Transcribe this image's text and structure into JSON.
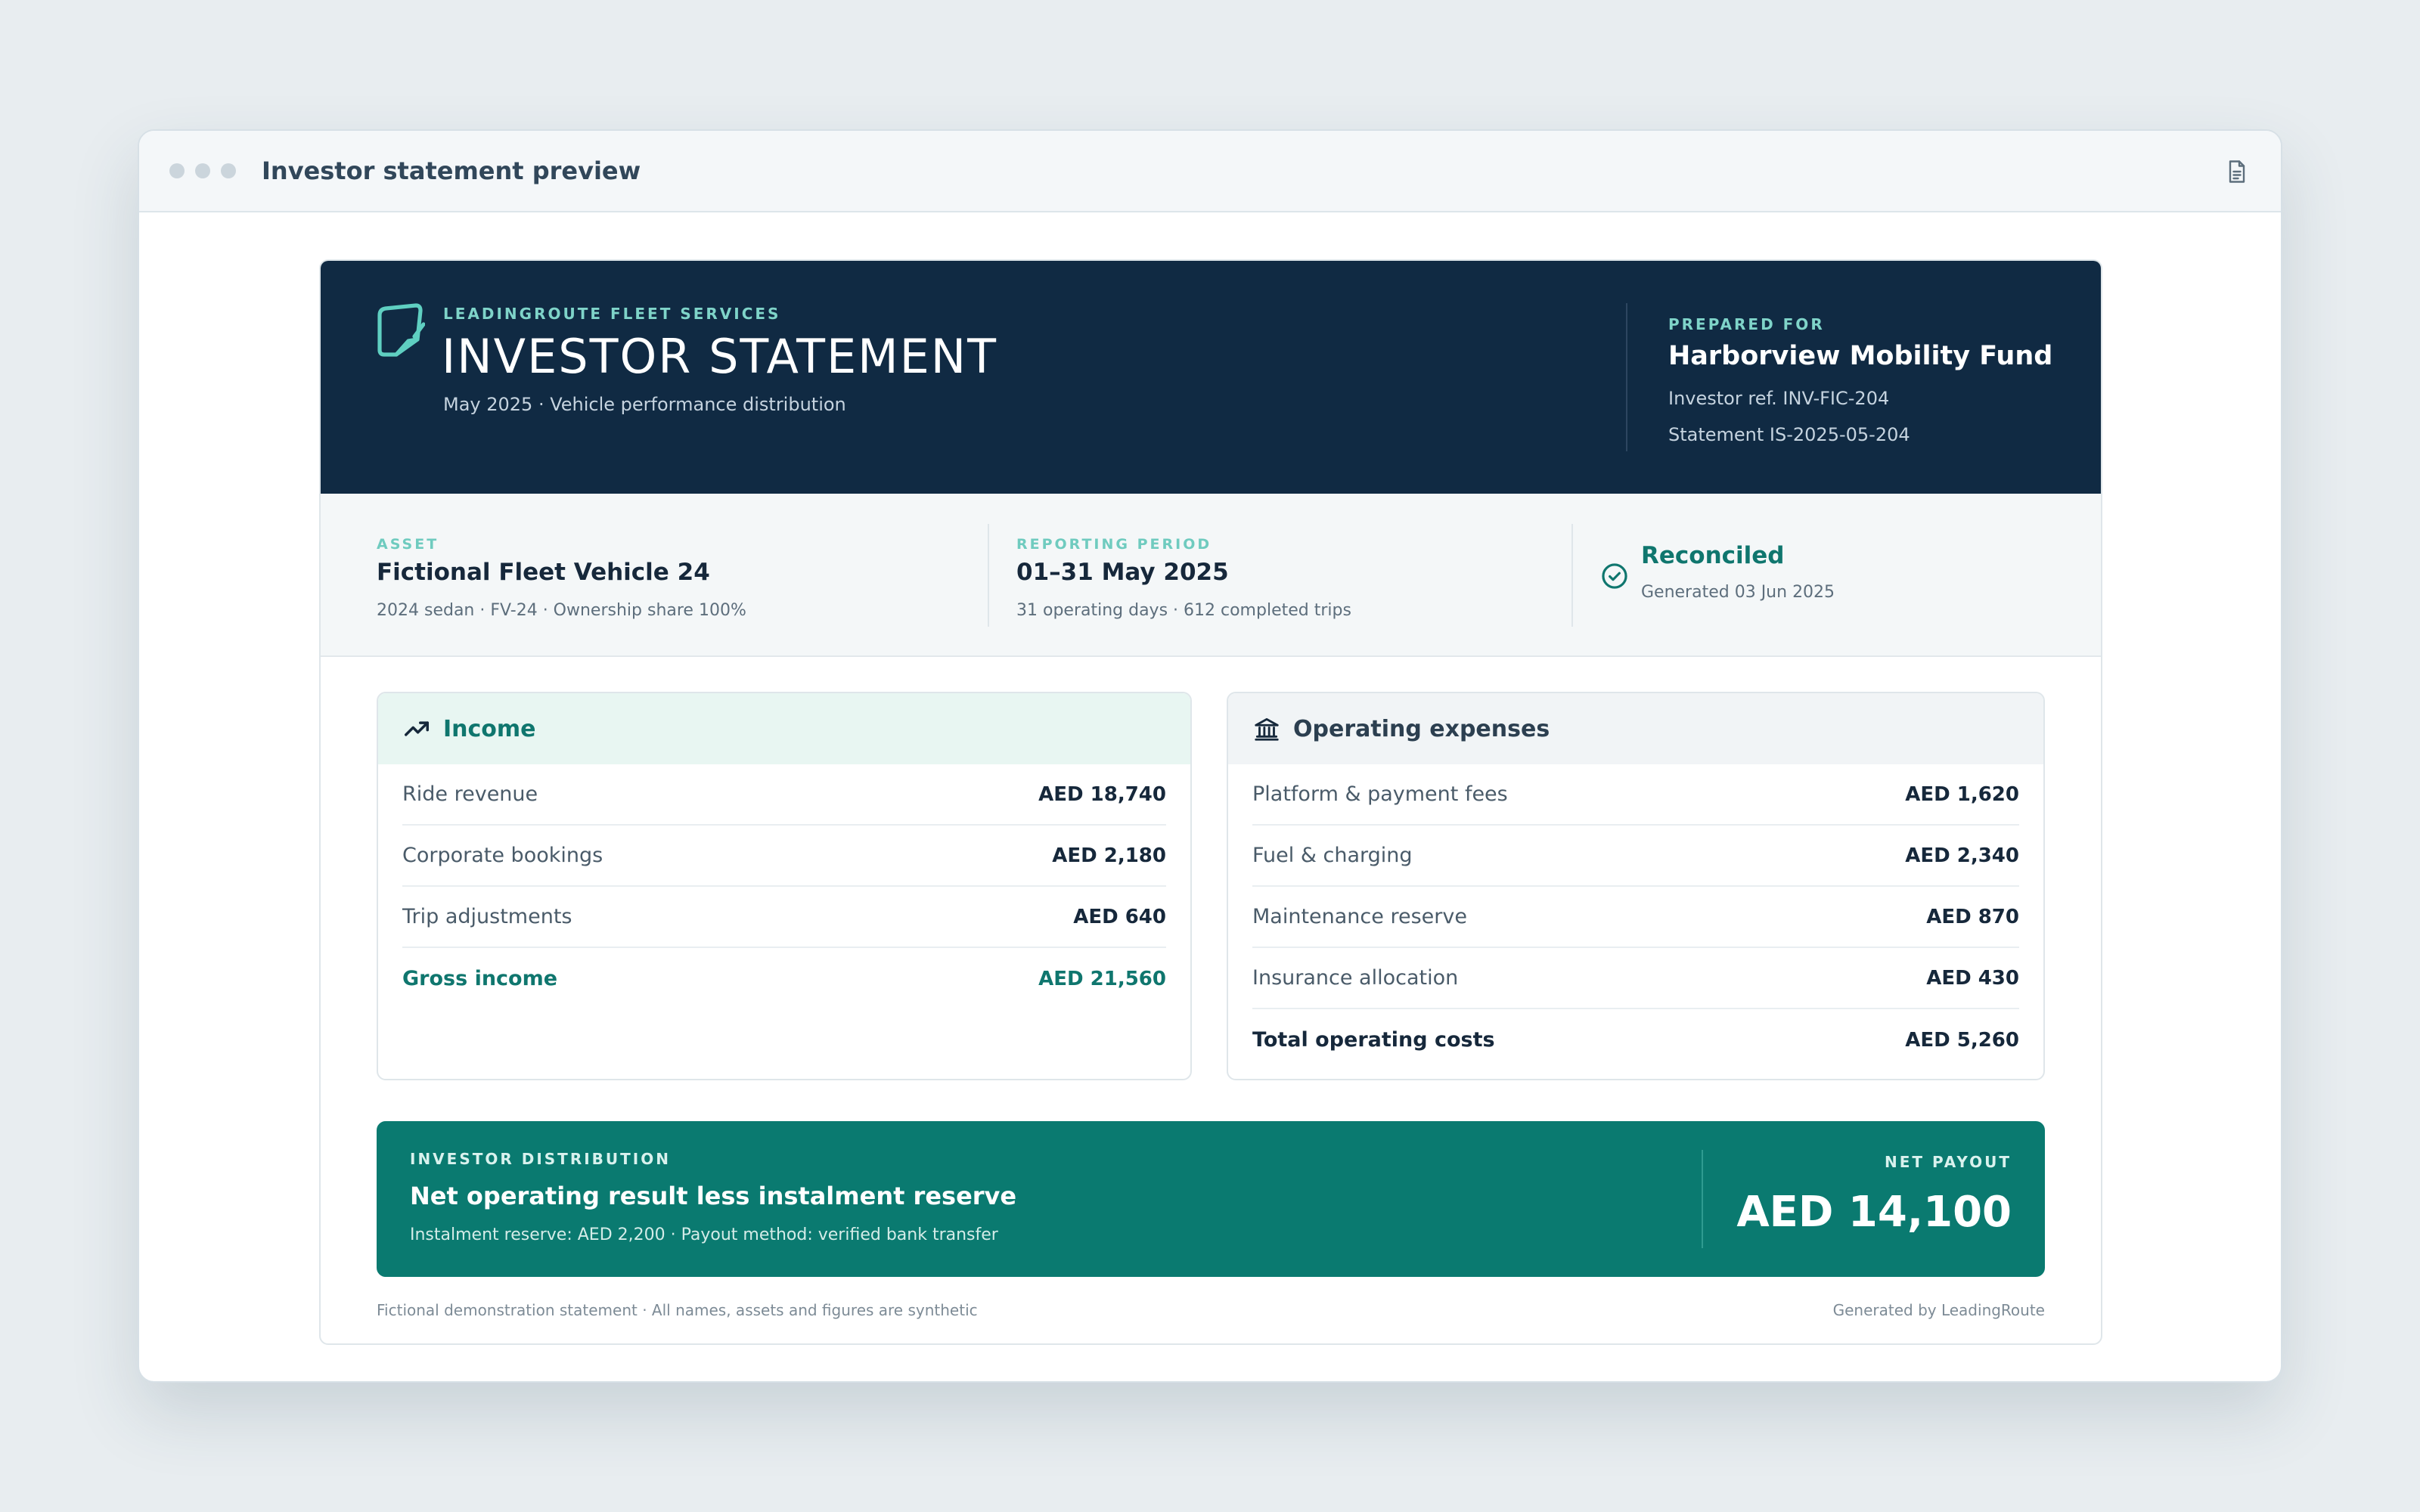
{
  "window": {
    "title": "Investor statement preview",
    "document_icon": "document-icon"
  },
  "hero": {
    "company": "LEADINGROUTE FLEET SERVICES",
    "title": "INVESTOR STATEMENT",
    "subtitle": "May 2025 · Vehicle performance distribution",
    "logo_icon": "document-note-icon",
    "prepared_for_label": "PREPARED FOR",
    "prepared_for_name": "Harborview Mobility Fund",
    "investor_ref": "Investor ref. INV-FIC-204",
    "statement_id": "Statement IS-2025-05-204"
  },
  "info": {
    "asset_label": "ASSET",
    "asset_name": "Fictional Fleet Vehicle 24",
    "asset_detail": "2024 sedan · FV-24 · Ownership share 100%",
    "period_label": "REPORTING PERIOD",
    "period_value": "01–31 May 2025",
    "period_detail": "31 operating days · 612 completed trips",
    "status_icon": "check-circle-icon",
    "status": "Reconciled",
    "generated": "Generated 03 Jun 2025"
  },
  "income": {
    "title": "Income",
    "icon": "trending-up-icon",
    "rows": [
      {
        "label": "Ride revenue",
        "value": "AED 18,740"
      },
      {
        "label": "Corporate bookings",
        "value": "AED 2,180"
      },
      {
        "label": "Trip adjustments",
        "value": "AED 640"
      }
    ],
    "total": {
      "label": "Gross income",
      "value": "AED 21,560"
    }
  },
  "expenses": {
    "title": "Operating expenses",
    "icon": "bank-icon",
    "rows": [
      {
        "label": "Platform & payment fees",
        "value": "AED 1,620"
      },
      {
        "label": "Fuel & charging",
        "value": "AED 2,340"
      },
      {
        "label": "Maintenance reserve",
        "value": "AED 870"
      },
      {
        "label": "Insurance allocation",
        "value": "AED 430"
      }
    ],
    "total": {
      "label": "Total operating costs",
      "value": "AED 5,260"
    }
  },
  "distribution": {
    "label": "INVESTOR DISTRIBUTION",
    "title": "Net operating result less instalment reserve",
    "detail": "Instalment reserve: AED 2,200 · Payout method: verified bank transfer",
    "net_label": "NET PAYOUT",
    "net_value": "AED 14,100"
  },
  "footer": {
    "disclaimer": "Fictional demonstration statement · All names, assets and figures are synthetic",
    "generator": "Generated by LeadingRoute"
  },
  "colors": {
    "navy": "#102a43",
    "teal": "#0a7a70",
    "accent": "#7fd4c9",
    "reconciled": "#0f766e"
  }
}
